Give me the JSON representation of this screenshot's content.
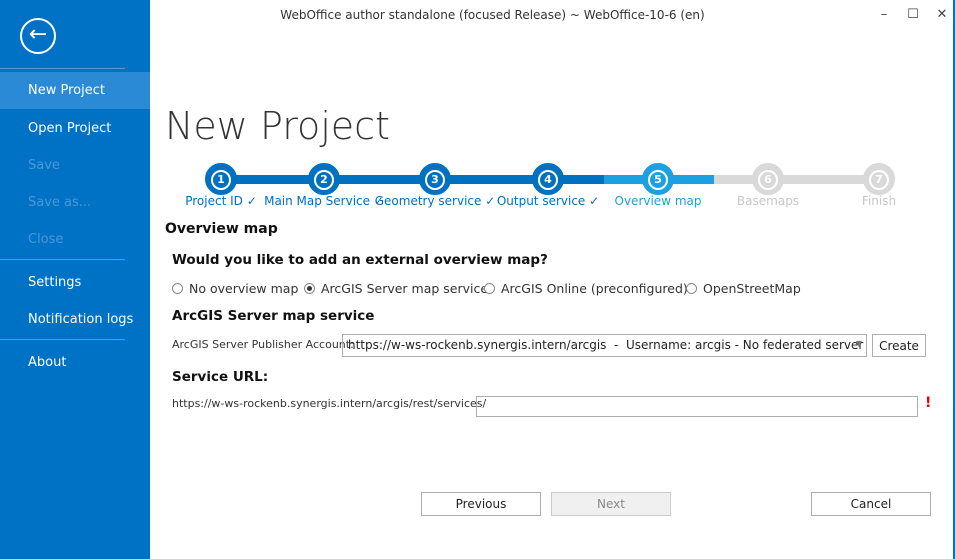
{
  "window": {
    "title": "WebOffice author standalone (focused Release) ~ WebOffice-10-6 (en)",
    "minimize": "–",
    "maximize": "☐",
    "close": "✕"
  },
  "sidebar": {
    "back": "←",
    "items": [
      {
        "label": "New Project",
        "state": "selected"
      },
      {
        "label": "Open Project",
        "state": "normal"
      },
      {
        "label": "Save",
        "state": "disabled"
      },
      {
        "label": "Save as...",
        "state": "disabled"
      },
      {
        "label": "Close",
        "state": "disabled"
      },
      {
        "label": "Settings",
        "state": "normal"
      },
      {
        "label": "Notification logs",
        "state": "normal"
      },
      {
        "label": "About",
        "state": "normal"
      }
    ]
  },
  "page_title": "New Project",
  "steps": [
    {
      "num": "1",
      "label": "Project ID ✓",
      "state": "done"
    },
    {
      "num": "2",
      "label": "Main Map Service ✓",
      "state": "done"
    },
    {
      "num": "3",
      "label": "Geometry service ✓",
      "state": "done"
    },
    {
      "num": "4",
      "label": "Output service ✓",
      "state": "done"
    },
    {
      "num": "5",
      "label": "Overview map",
      "state": "current"
    },
    {
      "num": "6",
      "label": "Basemaps",
      "state": "pending"
    },
    {
      "num": "7",
      "label": "Finish",
      "state": "pending"
    }
  ],
  "colors": {
    "done": "#0070c0",
    "current": "#1ba1e2",
    "pending": "#d9d9d9",
    "sidebar": "#0072c6"
  },
  "section": "Overview map",
  "question": "Would you like to add an external overview map?",
  "options": [
    {
      "label": "No overview map",
      "checked": false
    },
    {
      "label": "ArcGIS Server map service",
      "checked": true
    },
    {
      "label": "ArcGIS Online (preconfigured)",
      "checked": false
    },
    {
      "label": "OpenStreetMap",
      "checked": false
    }
  ],
  "arcgis": {
    "heading": "ArcGIS Server map service",
    "account_label": "ArcGIS Server Publisher Account:",
    "account_value": "https://w-ws-rockenb.synergis.intern/arcgis  -  Username: arcgis - No federated server",
    "create": "Create"
  },
  "service": {
    "heading": "Service URL:",
    "prefix": "https://w-ws-rockenb.synergis.intern/arcgis/rest/services/",
    "value": "",
    "error": "!"
  },
  "buttons": {
    "previous": "Previous",
    "next": "Next",
    "cancel": "Cancel"
  }
}
